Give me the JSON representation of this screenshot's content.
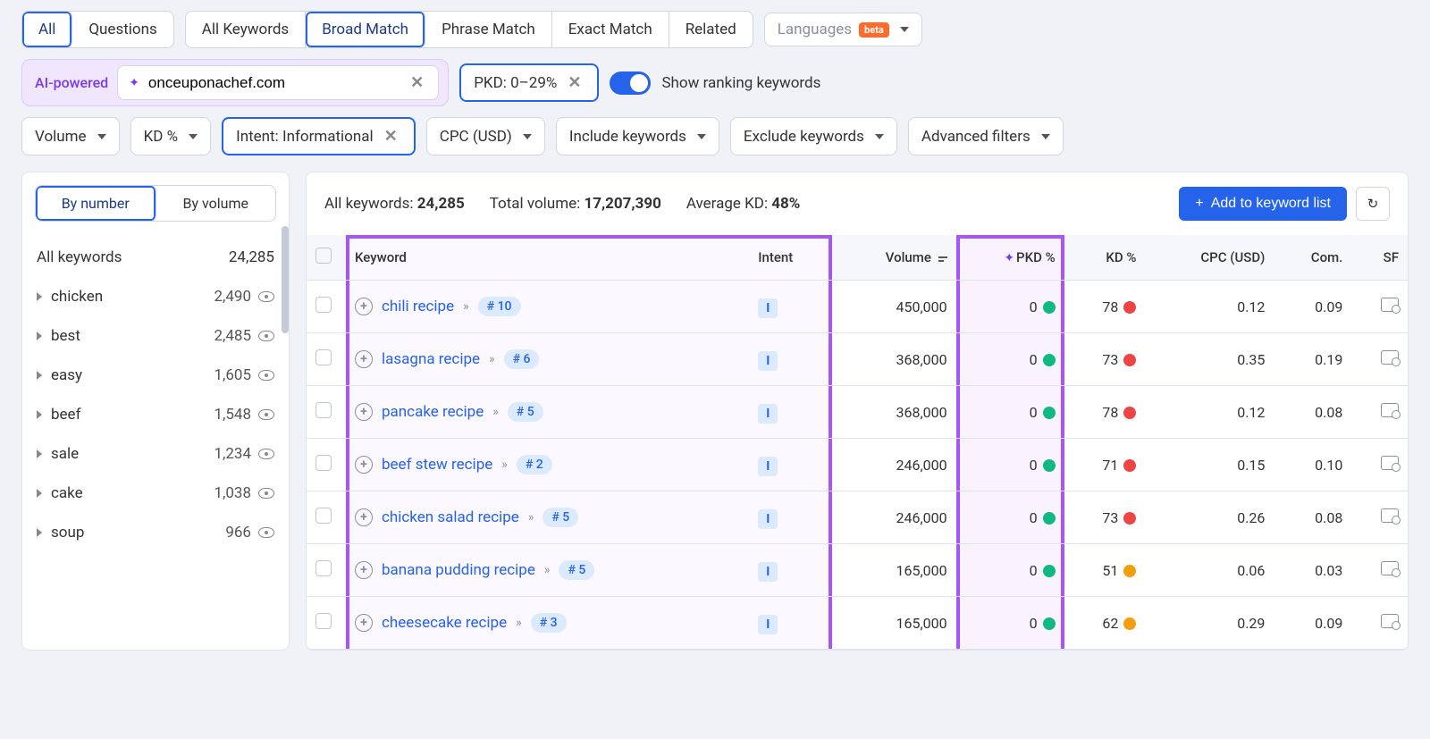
{
  "tabs_main": {
    "all": "All",
    "questions": "Questions"
  },
  "tabs_match": {
    "all_kw": "All Keywords",
    "broad": "Broad Match",
    "phrase": "Phrase Match",
    "exact": "Exact Match",
    "related": "Related"
  },
  "languages": {
    "label": "Languages",
    "beta": "beta"
  },
  "ai": {
    "label": "AI-powered",
    "domain": "onceuponachef.com"
  },
  "pkd_chip": "PKD: 0–29%",
  "show_ranking": "Show ranking keywords",
  "filters": {
    "volume": "Volume",
    "kd": "KD %",
    "intent": "Intent: Informational",
    "cpc": "CPC (USD)",
    "include": "Include keywords",
    "exclude": "Exclude keywords",
    "advanced": "Advanced filters"
  },
  "sidebar": {
    "by_number": "By number",
    "by_volume": "By volume",
    "all_kw_label": "All keywords",
    "all_kw_count": "24,285",
    "items": [
      {
        "label": "chicken",
        "count": "2,490"
      },
      {
        "label": "best",
        "count": "2,485"
      },
      {
        "label": "easy",
        "count": "1,605"
      },
      {
        "label": "beef",
        "count": "1,548"
      },
      {
        "label": "sale",
        "count": "1,234"
      },
      {
        "label": "cake",
        "count": "1,038"
      },
      {
        "label": "soup",
        "count": "966"
      }
    ]
  },
  "stats": {
    "all_kw_l": "All keywords: ",
    "all_kw_v": "24,285",
    "tot_l": "Total volume: ",
    "tot_v": "17,207,390",
    "avg_l": "Average KD: ",
    "avg_v": "48%"
  },
  "add_btn": "Add to keyword list",
  "cols": {
    "keyword": "Keyword",
    "intent": "Intent",
    "volume": "Volume",
    "pkd": "PKD %",
    "kd": "KD %",
    "cpc": "CPC (USD)",
    "com": "Com.",
    "sf": "SF"
  },
  "rows": [
    {
      "kw": "chili recipe",
      "rank": "# 10",
      "intent": "I",
      "vol": "450,000",
      "pkd": "0",
      "pkd_dot": "g",
      "kd": "78",
      "kd_dot": "r2",
      "cpc": "0.12",
      "com": "0.09"
    },
    {
      "kw": "lasagna recipe",
      "rank": "# 6",
      "intent": "I",
      "vol": "368,000",
      "pkd": "0",
      "pkd_dot": "g",
      "kd": "73",
      "kd_dot": "r2",
      "cpc": "0.35",
      "com": "0.19"
    },
    {
      "kw": "pancake recipe",
      "rank": "# 5",
      "intent": "I",
      "vol": "368,000",
      "pkd": "0",
      "pkd_dot": "g",
      "kd": "78",
      "kd_dot": "r2",
      "cpc": "0.12",
      "com": "0.08"
    },
    {
      "kw": "beef stew recipe",
      "rank": "# 2",
      "intent": "I",
      "vol": "246,000",
      "pkd": "0",
      "pkd_dot": "g",
      "kd": "71",
      "kd_dot": "r2",
      "cpc": "0.15",
      "com": "0.10"
    },
    {
      "kw": "chicken salad recipe",
      "rank": "# 5",
      "intent": "I",
      "vol": "246,000",
      "pkd": "0",
      "pkd_dot": "g",
      "kd": "73",
      "kd_dot": "r2",
      "cpc": "0.26",
      "com": "0.08"
    },
    {
      "kw": "banana pudding recipe",
      "rank": "# 5",
      "intent": "I",
      "vol": "165,000",
      "pkd": "0",
      "pkd_dot": "g",
      "kd": "51",
      "kd_dot": "o",
      "cpc": "0.06",
      "com": "0.03"
    },
    {
      "kw": "cheesecake recipe",
      "rank": "# 3",
      "intent": "I",
      "vol": "165,000",
      "pkd": "0",
      "pkd_dot": "g",
      "kd": "62",
      "kd_dot": "o",
      "cpc": "0.29",
      "com": "0.09"
    }
  ]
}
